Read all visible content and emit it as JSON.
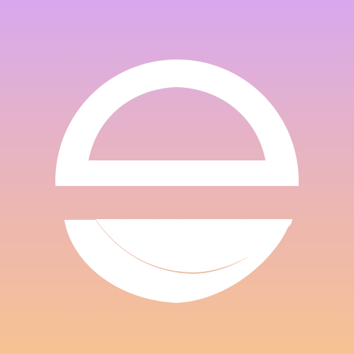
{
  "app_icon": {
    "icon": "letter-e-logo-icon",
    "colors": {
      "gradient_top": "#d8a8ee",
      "gradient_upper_mid": "#e3b1cf",
      "gradient_lower_mid": "#ecb7b1",
      "gradient_bottom": "#f7c292",
      "glyph": "#ffffff"
    }
  }
}
